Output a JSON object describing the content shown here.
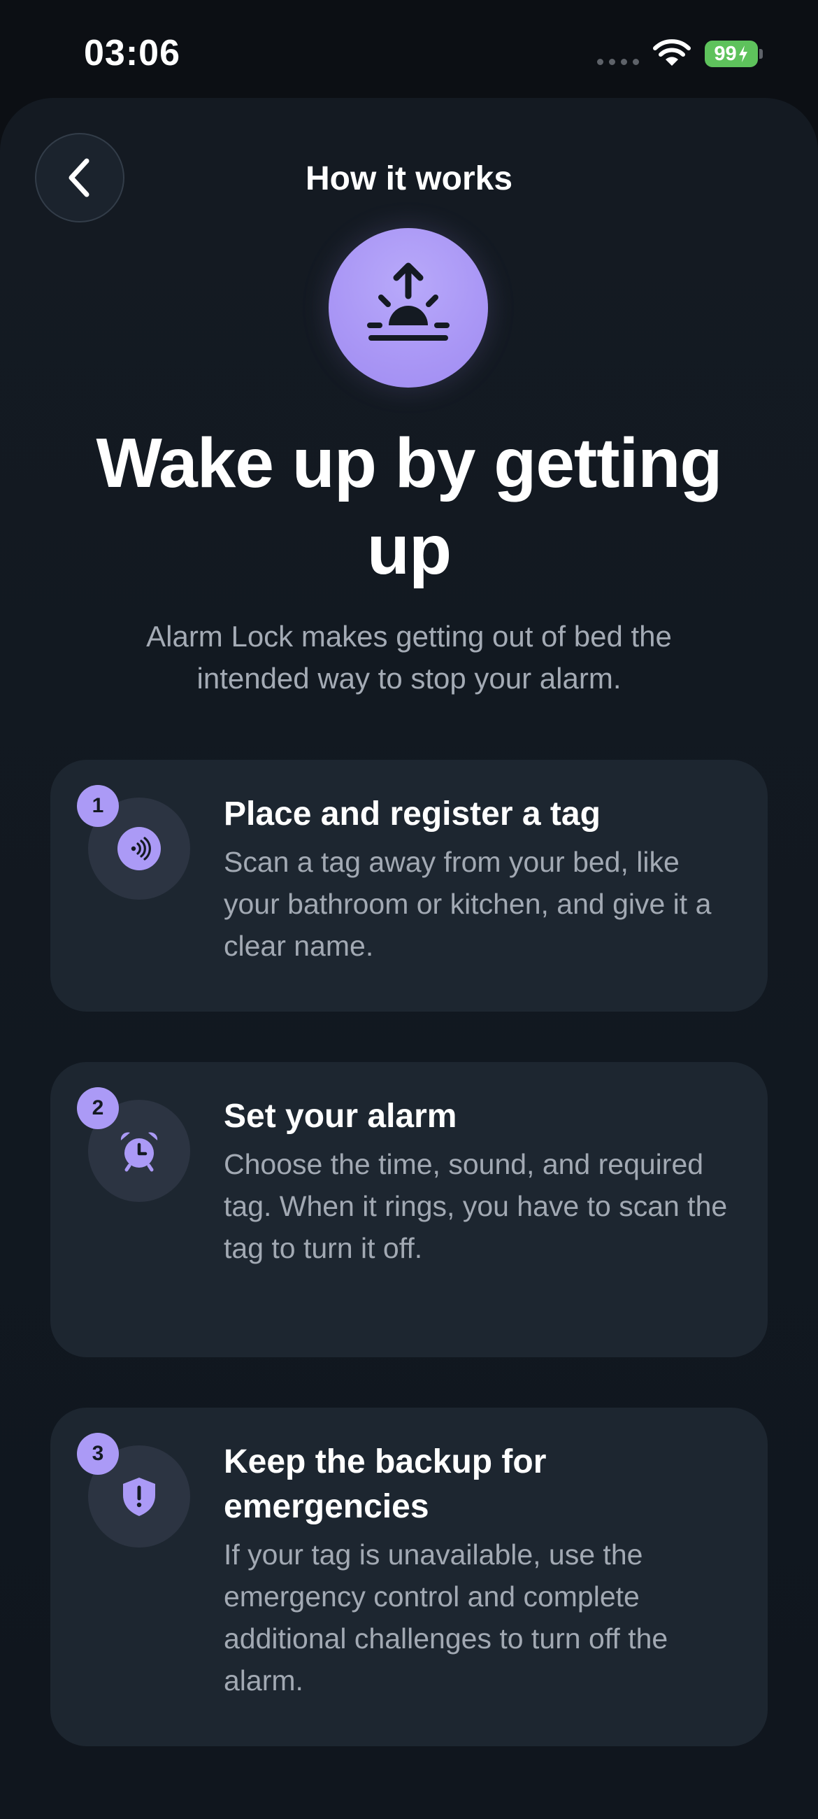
{
  "status_bar": {
    "time": "03:06",
    "battery_level": "99"
  },
  "icons": {
    "back": "chevron-left-icon",
    "hero": "sunrise-icon",
    "step_1": "nfc-tag-icon",
    "step_2": "alarm-clock-icon",
    "step_3": "shield-alert-icon"
  },
  "colors": {
    "accent": "#ab9af6",
    "background": "#0c0f14",
    "card": "#1d2630",
    "battery": "#5ec25c"
  },
  "header": {
    "title": "How it works"
  },
  "hero": {
    "title": "Wake up by getting up",
    "subtitle": "Alarm Lock makes getting out of bed the intended way to stop your alarm."
  },
  "steps": [
    {
      "number": "1",
      "title": "Place and register a tag",
      "body": "Scan a tag away from your bed, like your bathroom or kitchen, and give it a clear name."
    },
    {
      "number": "2",
      "title": "Set your alarm",
      "body": "Choose the time, sound, and required tag. When it rings, you have to scan the tag to turn it off."
    },
    {
      "number": "3",
      "title": "Keep the backup for emergencies",
      "body": "If your tag is unavailable, use the emergency control and complete additional challenges to turn off the alarm."
    }
  ]
}
